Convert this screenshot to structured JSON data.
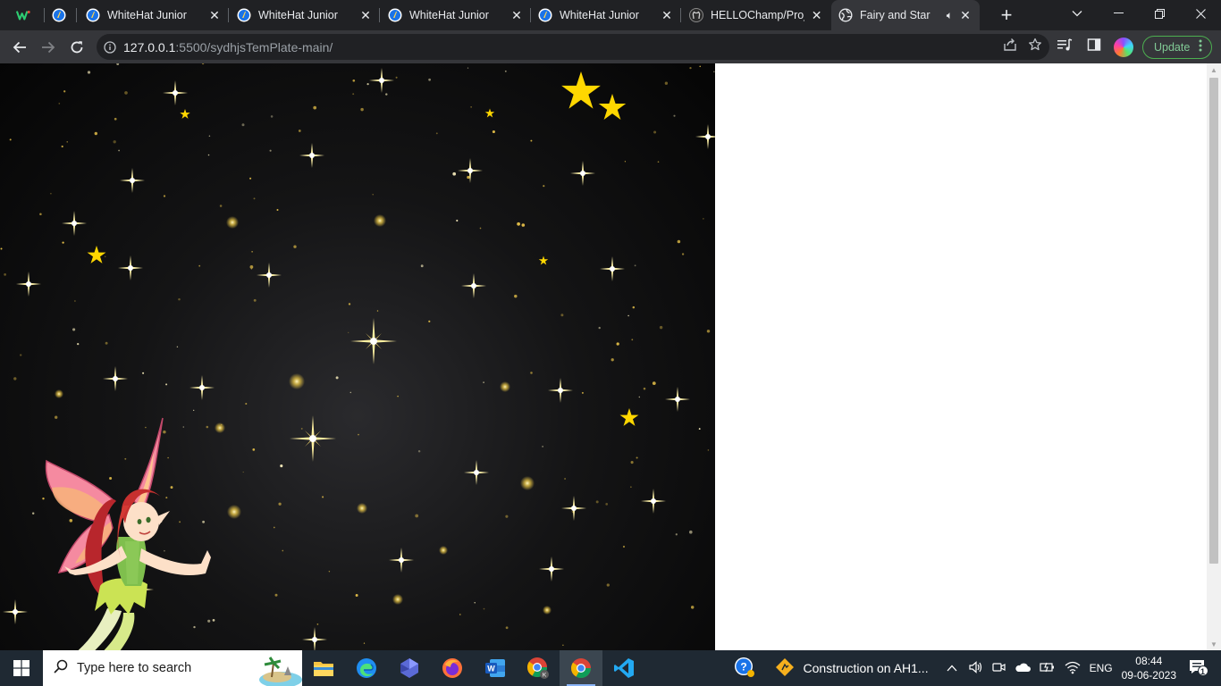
{
  "browser": {
    "tabs": [
      {
        "title": "",
        "favicon": "whitehat-w-logo",
        "close": false
      },
      {
        "title": "",
        "favicon": "whitehat-jr-icon",
        "close": false
      },
      {
        "title": "WhiteHat Junior",
        "favicon": "whitehat-jr-icon",
        "close": true
      },
      {
        "title": "WhiteHat Junior",
        "favicon": "whitehat-jr-icon",
        "close": true
      },
      {
        "title": "WhiteHat Junior",
        "favicon": "whitehat-jr-icon",
        "close": true
      },
      {
        "title": "WhiteHat Junior",
        "favicon": "whitehat-jr-icon",
        "close": true
      },
      {
        "title": "HELLOChamp/Proje",
        "favicon": "github-icon",
        "close": true
      },
      {
        "title": "Fairy and Star",
        "favicon": "globe-icon",
        "close": true,
        "active": true,
        "audio": true
      }
    ],
    "new_tab_label": "+",
    "address": {
      "host": "127.0.0.1",
      "rest": ":5500/sydhjsTemPlate-main/"
    },
    "update_label": "Update"
  },
  "scene": {
    "title": "Fairy and Star",
    "star_color": "#ffd700",
    "background": "#0a0a0b"
  },
  "taskbar": {
    "search_placeholder": "Type here to search",
    "apps": [
      "file-explorer-icon",
      "edge-icon",
      "copilot-icon",
      "firefox-icon",
      "word-icon",
      "chrome-profile-icon",
      "chrome-icon",
      "vscode-icon"
    ],
    "notification_text": "Construction on AH1...",
    "language": "ENG",
    "time": "08:44",
    "date": "09-06-2023",
    "notification_count": "1"
  }
}
